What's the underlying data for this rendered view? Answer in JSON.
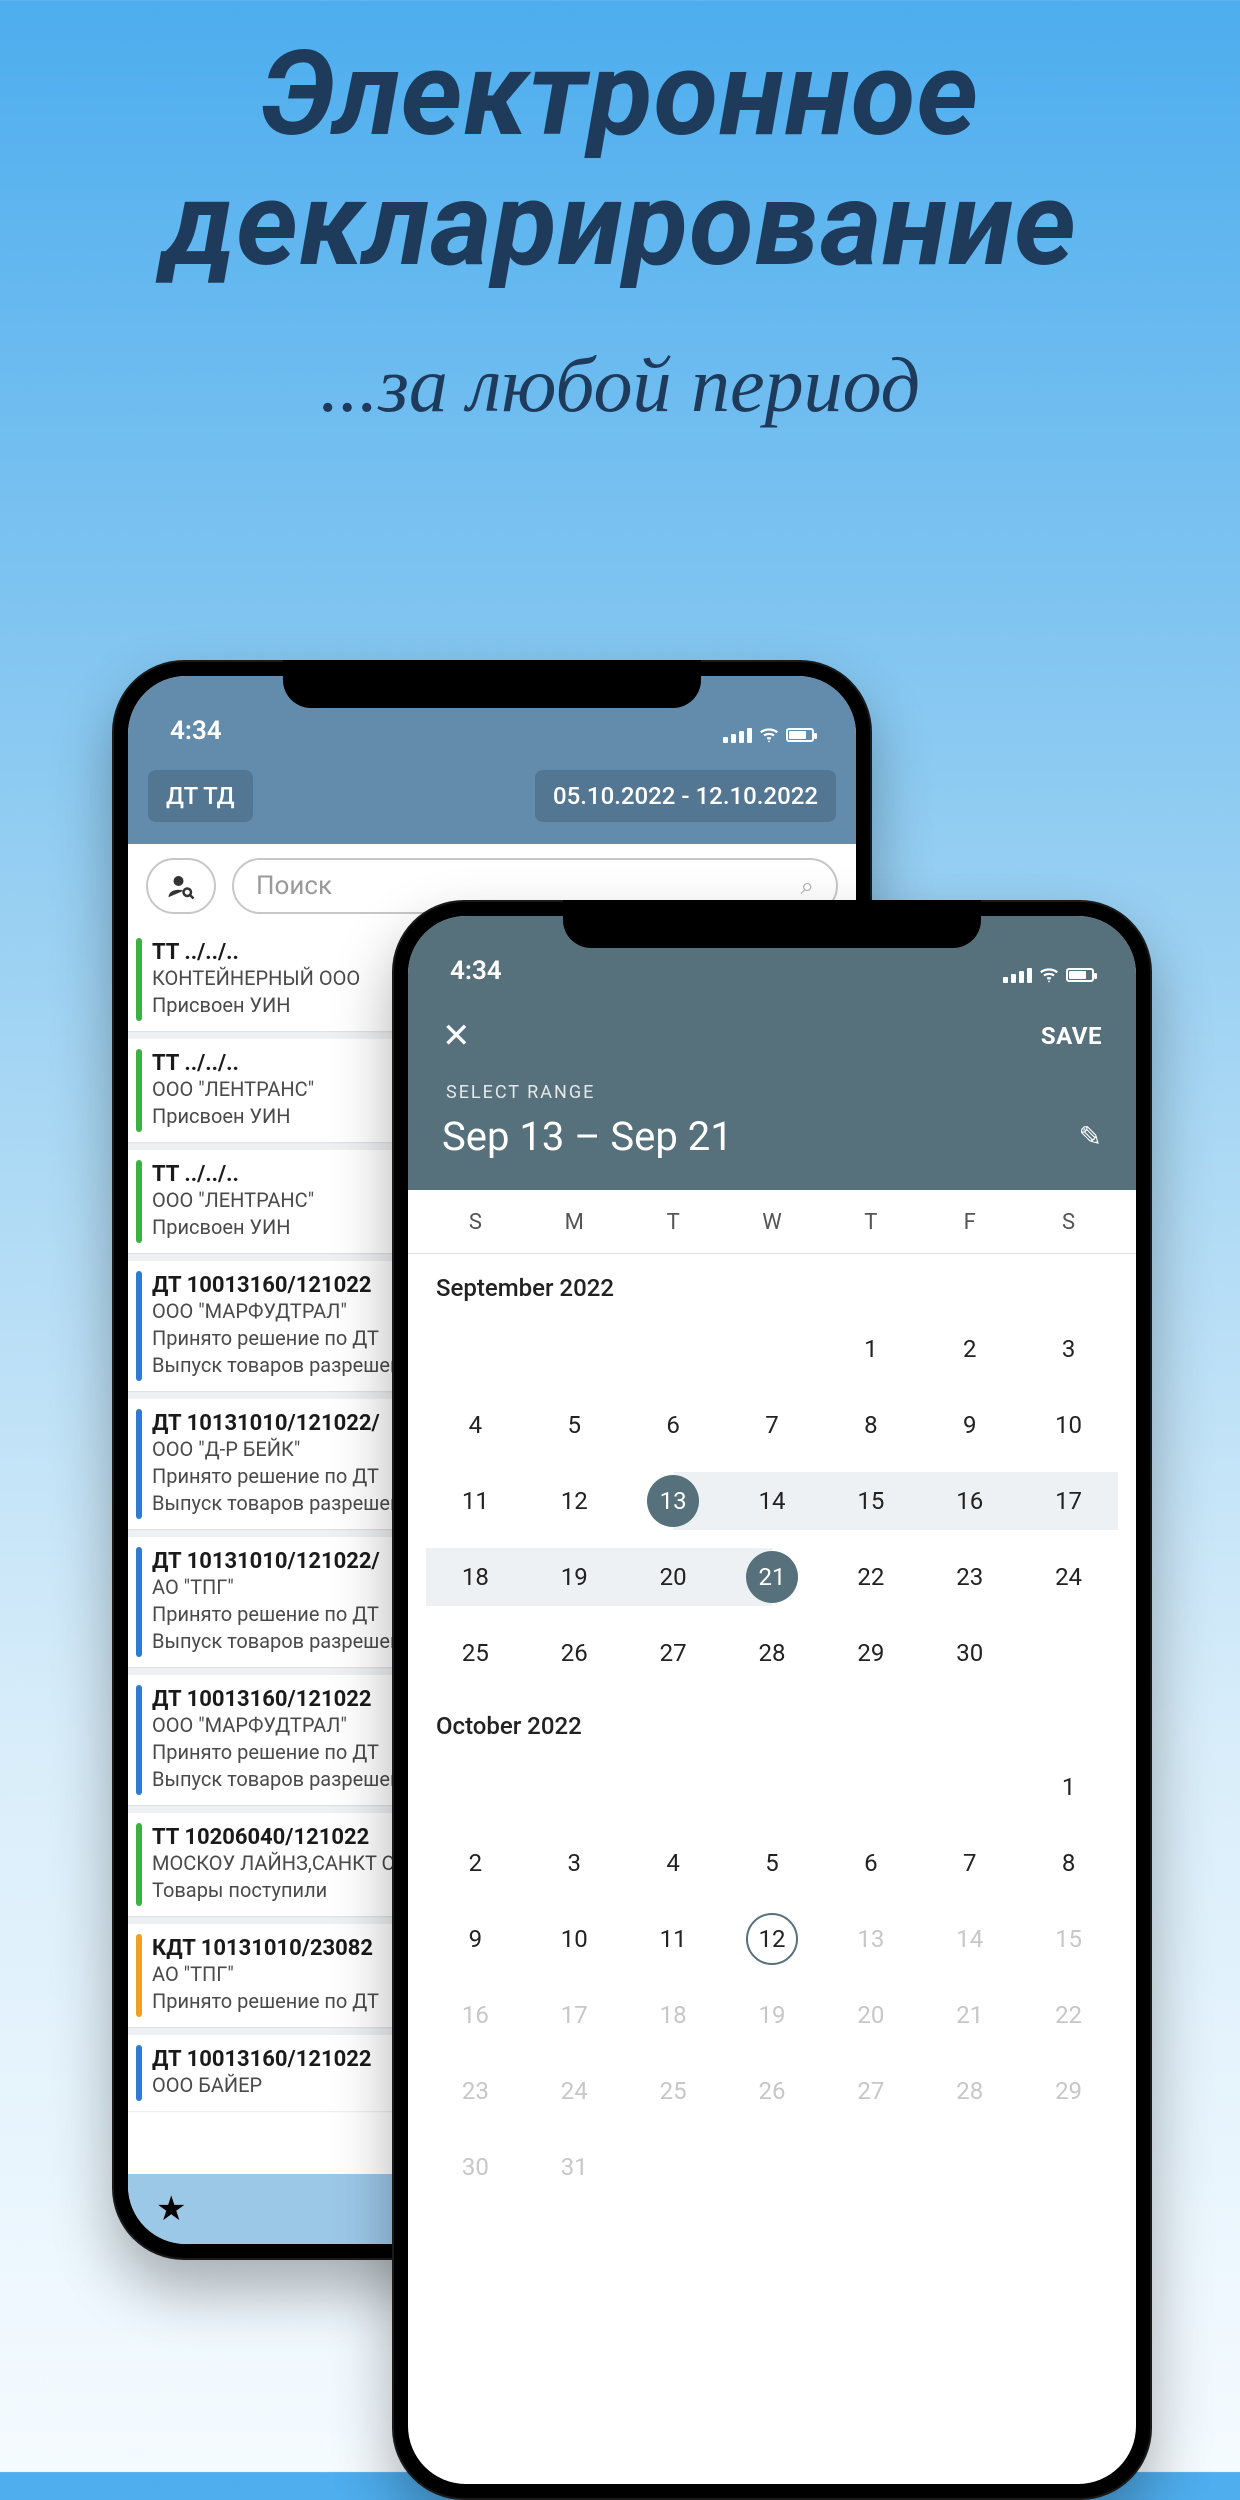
{
  "headline": "Электронное декларирование",
  "subhead": "...за любой период",
  "backPhone": {
    "time": "4:34",
    "tabChip": "ДТ ТД",
    "dateChip": "05.10.2022 - 12.10.2022",
    "searchPlaceholder": "Поиск",
    "items": [
      {
        "stripe": "green",
        "title": "TT ../../..",
        "l2": "КОНТЕЙНЕРНЫЙ ООО",
        "l3": "Присвоен УИН",
        "l4": ""
      },
      {
        "stripe": "green",
        "title": "TT ../../..",
        "l2": "ООО \"ЛЕНТРАНС\"",
        "l3": "Присвоен УИН",
        "l4": ""
      },
      {
        "stripe": "green",
        "title": "TT ../../..",
        "l2": "ООО \"ЛЕНТРАНС\"",
        "l3": "Присвоен УИН",
        "l4": ""
      },
      {
        "stripe": "blue",
        "title": "ДТ 10013160/121022",
        "l2": "ООО \"МАРФУДТРАЛ\"",
        "l3": "Принято решение по ДТ",
        "l4": "Выпуск товаров разрешен"
      },
      {
        "stripe": "blue",
        "title": "ДТ 10131010/121022/",
        "l2": "ООО \"Д-Р БЕЙК\"",
        "l3": "Принято решение по ДТ",
        "l4": "Выпуск товаров разрешен"
      },
      {
        "stripe": "blue",
        "title": "ДТ 10131010/121022/",
        "l2": "АО \"ТПГ\"",
        "l3": "Принято решение по ДТ",
        "l4": "Выпуск товаров разрешен"
      },
      {
        "stripe": "blue",
        "title": "ДТ 10013160/121022",
        "l2": "ООО \"МАРФУДТРАЛ\"",
        "l3": "Принято решение по ДТ",
        "l4": "Выпуск товаров разрешен"
      },
      {
        "stripe": "green",
        "title": "ТТ 10206040/121022",
        "l2": "МОСКОУ ЛАЙНЗ,САНКТ ООО",
        "l3": "Товары поступили",
        "l4": ""
      },
      {
        "stripe": "orange",
        "title": "КДТ 10131010/23082",
        "l2": "АО \"ТПГ\"",
        "l3": "Принято решение по ДТ",
        "l4": ""
      },
      {
        "stripe": "blue",
        "title": "ДТ 10013160/121022",
        "l2": "ООО БАЙЕР",
        "l3": "",
        "l4": ""
      }
    ]
  },
  "frontPhone": {
    "time": "4:34",
    "save": "SAVE",
    "selectLabel": "SELECT RANGE",
    "rangeValue": "Sep 13 – Sep 21",
    "weekdays": [
      "S",
      "M",
      "T",
      "W",
      "T",
      "F",
      "S"
    ],
    "month1": "September 2022",
    "month2": "October 2022",
    "sep": {
      "leading_blanks": 4,
      "days": 30,
      "range_start": 13,
      "range_end": 21
    },
    "oct": {
      "leading_blanks": 6,
      "days": 31,
      "today": 12,
      "faded_from": 13
    }
  }
}
